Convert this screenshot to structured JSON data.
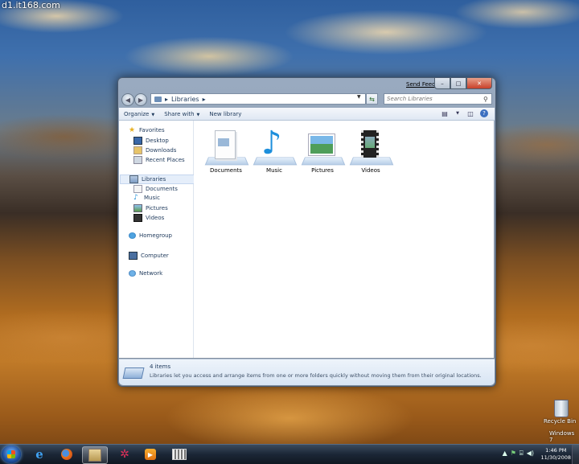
{
  "watermark": "d1.it168.com",
  "window": {
    "send_feedback": "Send Feedback",
    "caption": {
      "minimize": "–",
      "maximize": "□",
      "close": "✕"
    },
    "address": {
      "path": [
        "Libraries"
      ],
      "sep": "▸"
    },
    "search": {
      "placeholder": "Search Libraries"
    },
    "toolbar": {
      "organize": "Organize",
      "share_with": "Share with",
      "new_library": "New library"
    },
    "nav": {
      "favorites": {
        "label": "Favorites",
        "items": [
          "Desktop",
          "Downloads",
          "Recent Places"
        ]
      },
      "libraries": {
        "label": "Libraries",
        "items": [
          "Documents",
          "Music",
          "Pictures",
          "Videos"
        ]
      },
      "homegroup": "Homegroup",
      "computer": "Computer",
      "network": "Network"
    },
    "libraries": [
      {
        "label": "Documents",
        "icon": "documents-library-icon"
      },
      {
        "label": "Music",
        "icon": "music-library-icon"
      },
      {
        "label": "Pictures",
        "icon": "pictures-library-icon"
      },
      {
        "label": "Videos",
        "icon": "videos-library-icon"
      }
    ],
    "details": {
      "count": "4 items",
      "description": "Libraries let you access and arrange items from one or more folders quickly without moving them from their original locations."
    }
  },
  "desktop": {
    "recycle_bin": "Recycle Bin",
    "os_label": "Windows 7"
  },
  "taskbar": {
    "clock": {
      "time": "1:46 PM",
      "date": "11/30/2008"
    },
    "tray_icons": [
      "show-hidden-icons",
      "action-center-icon",
      "network-icon",
      "volume-icon"
    ]
  },
  "colors": {
    "accent": "#3b6fc0",
    "window_text": "#1e395b",
    "selection": "#e5eefa"
  }
}
